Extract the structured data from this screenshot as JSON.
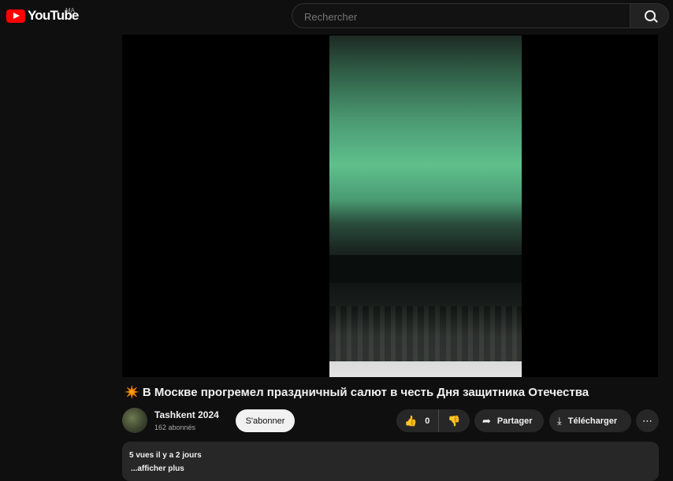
{
  "header": {
    "logo_text": "YouTube",
    "region": "MA",
    "search_placeholder": "Rechercher"
  },
  "video": {
    "title": "В Москве прогремел праздничный салют в честь Дня защитника Отечества",
    "title_icon": "✴️"
  },
  "channel": {
    "name": "Tashkent 2024",
    "subscribers": "162 abonnés",
    "subscribe_label": "S'abonner"
  },
  "actions": {
    "like_count": "0",
    "share_label": "Partager",
    "download_label": "Télécharger"
  },
  "description": {
    "views": "5 vues",
    "date": "il y a 2 jours",
    "more_label": "...afficher plus"
  },
  "icons": {
    "like": "thumbs-up-icon",
    "dislike": "thumbs-down-icon",
    "share": "share-arrow-icon",
    "download": "download-icon",
    "more": "more-dots-icon",
    "search": "search-icon"
  },
  "colors": {
    "brand": "#ff0000",
    "background": "#0f0f0f",
    "pill": "#272727"
  }
}
